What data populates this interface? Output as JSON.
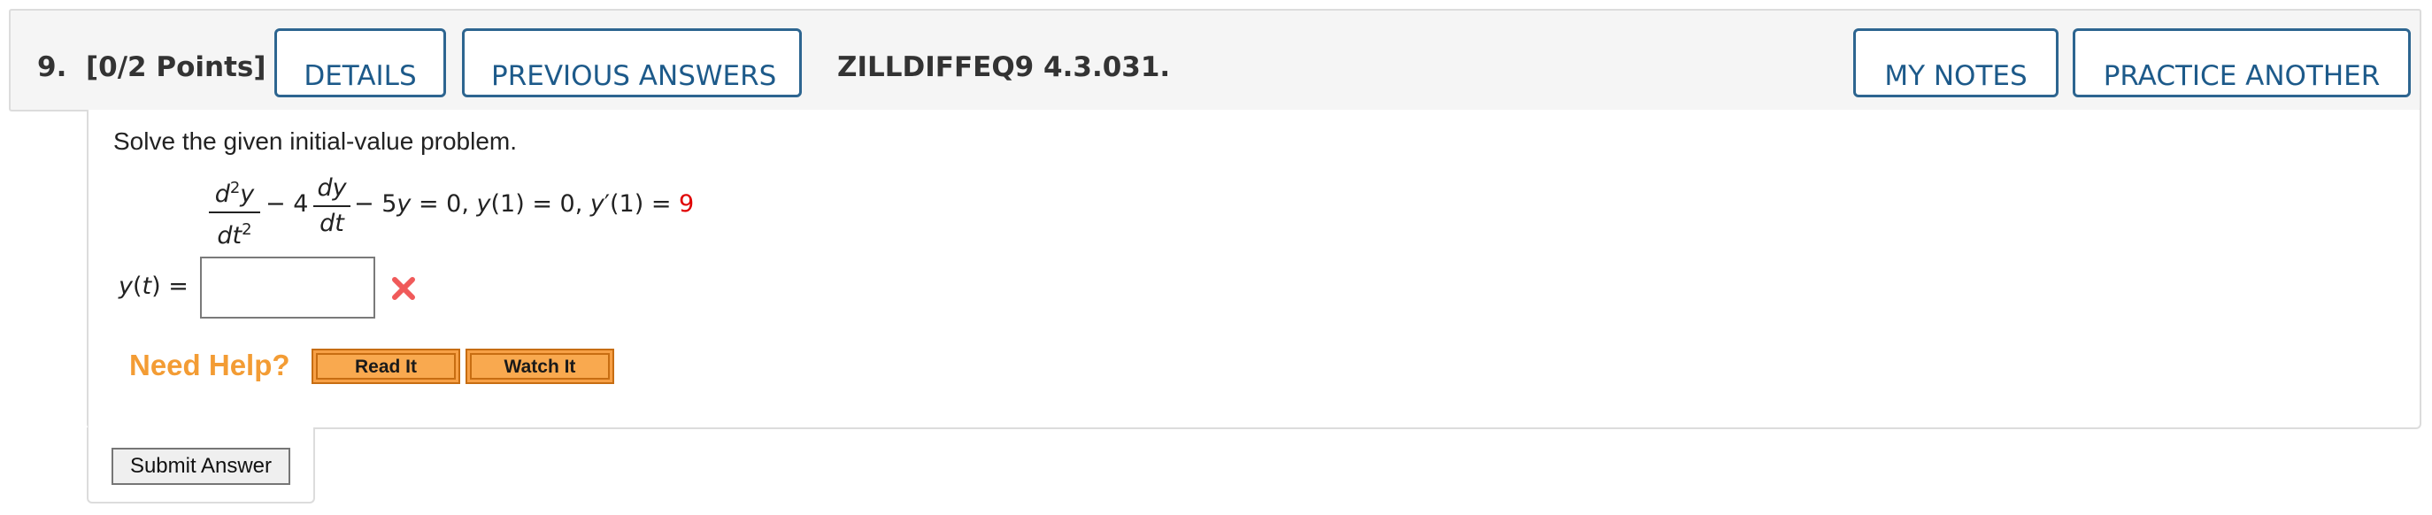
{
  "header": {
    "question_number": "9.",
    "points": "[0/2 Points]",
    "details_label": "DETAILS",
    "previous_answers_label": "PREVIOUS ANSWERS",
    "problem_code": "ZILLDIFFEQ9 4.3.031.",
    "my_notes_label": "MY NOTES",
    "practice_another_label": "PRACTICE ANOTHER"
  },
  "problem": {
    "instruction": "Solve the given initial-value problem.",
    "equation": {
      "frac1_num": "d",
      "frac1_num_sup": "2",
      "frac1_num_var": "y",
      "frac1_den": "dt",
      "frac1_den_sup": "2",
      "minus1": " − 4",
      "frac2_num": "dy",
      "frac2_den": "dt",
      "rest_a": " − 5",
      "rest_y": "y",
      "rest_b": " = 0,  ",
      "ic1_y": "y",
      "ic1_rest": "(1) = 0, ",
      "ic2_y": "y",
      "ic2_rest": "′(1) = ",
      "ic2_value": "9"
    },
    "answer_label_var": "y",
    "answer_label_arg": "(",
    "answer_label_t": "t",
    "answer_label_end": ") =",
    "answer_value": "",
    "status": "incorrect",
    "status_color": "#f05a5a"
  },
  "help": {
    "need_help_label": "Need Help?",
    "read_it_label": "Read It",
    "watch_it_label": "Watch It",
    "accent_color": "#f39c34"
  },
  "submit_label": "Submit Answer",
  "colors": {
    "header_button_border": "#2d6590",
    "header_button_text": "#1d5a8a",
    "highlight_red": "#e00000"
  }
}
